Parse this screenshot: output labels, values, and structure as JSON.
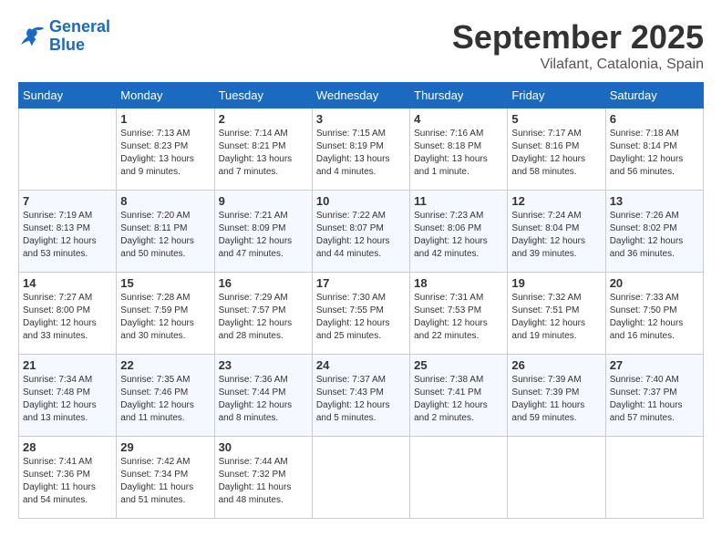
{
  "header": {
    "logo_line1": "General",
    "logo_line2": "Blue",
    "month": "September 2025",
    "location": "Vilafant, Catalonia, Spain"
  },
  "weekdays": [
    "Sunday",
    "Monday",
    "Tuesday",
    "Wednesday",
    "Thursday",
    "Friday",
    "Saturday"
  ],
  "weeks": [
    [
      {
        "day": "",
        "info": ""
      },
      {
        "day": "1",
        "info": "Sunrise: 7:13 AM\nSunset: 8:23 PM\nDaylight: 13 hours\nand 9 minutes."
      },
      {
        "day": "2",
        "info": "Sunrise: 7:14 AM\nSunset: 8:21 PM\nDaylight: 13 hours\nand 7 minutes."
      },
      {
        "day": "3",
        "info": "Sunrise: 7:15 AM\nSunset: 8:19 PM\nDaylight: 13 hours\nand 4 minutes."
      },
      {
        "day": "4",
        "info": "Sunrise: 7:16 AM\nSunset: 8:18 PM\nDaylight: 13 hours\nand 1 minute."
      },
      {
        "day": "5",
        "info": "Sunrise: 7:17 AM\nSunset: 8:16 PM\nDaylight: 12 hours\nand 58 minutes."
      },
      {
        "day": "6",
        "info": "Sunrise: 7:18 AM\nSunset: 8:14 PM\nDaylight: 12 hours\nand 56 minutes."
      }
    ],
    [
      {
        "day": "7",
        "info": "Sunrise: 7:19 AM\nSunset: 8:13 PM\nDaylight: 12 hours\nand 53 minutes."
      },
      {
        "day": "8",
        "info": "Sunrise: 7:20 AM\nSunset: 8:11 PM\nDaylight: 12 hours\nand 50 minutes."
      },
      {
        "day": "9",
        "info": "Sunrise: 7:21 AM\nSunset: 8:09 PM\nDaylight: 12 hours\nand 47 minutes."
      },
      {
        "day": "10",
        "info": "Sunrise: 7:22 AM\nSunset: 8:07 PM\nDaylight: 12 hours\nand 44 minutes."
      },
      {
        "day": "11",
        "info": "Sunrise: 7:23 AM\nSunset: 8:06 PM\nDaylight: 12 hours\nand 42 minutes."
      },
      {
        "day": "12",
        "info": "Sunrise: 7:24 AM\nSunset: 8:04 PM\nDaylight: 12 hours\nand 39 minutes."
      },
      {
        "day": "13",
        "info": "Sunrise: 7:26 AM\nSunset: 8:02 PM\nDaylight: 12 hours\nand 36 minutes."
      }
    ],
    [
      {
        "day": "14",
        "info": "Sunrise: 7:27 AM\nSunset: 8:00 PM\nDaylight: 12 hours\nand 33 minutes."
      },
      {
        "day": "15",
        "info": "Sunrise: 7:28 AM\nSunset: 7:59 PM\nDaylight: 12 hours\nand 30 minutes."
      },
      {
        "day": "16",
        "info": "Sunrise: 7:29 AM\nSunset: 7:57 PM\nDaylight: 12 hours\nand 28 minutes."
      },
      {
        "day": "17",
        "info": "Sunrise: 7:30 AM\nSunset: 7:55 PM\nDaylight: 12 hours\nand 25 minutes."
      },
      {
        "day": "18",
        "info": "Sunrise: 7:31 AM\nSunset: 7:53 PM\nDaylight: 12 hours\nand 22 minutes."
      },
      {
        "day": "19",
        "info": "Sunrise: 7:32 AM\nSunset: 7:51 PM\nDaylight: 12 hours\nand 19 minutes."
      },
      {
        "day": "20",
        "info": "Sunrise: 7:33 AM\nSunset: 7:50 PM\nDaylight: 12 hours\nand 16 minutes."
      }
    ],
    [
      {
        "day": "21",
        "info": "Sunrise: 7:34 AM\nSunset: 7:48 PM\nDaylight: 12 hours\nand 13 minutes."
      },
      {
        "day": "22",
        "info": "Sunrise: 7:35 AM\nSunset: 7:46 PM\nDaylight: 12 hours\nand 11 minutes."
      },
      {
        "day": "23",
        "info": "Sunrise: 7:36 AM\nSunset: 7:44 PM\nDaylight: 12 hours\nand 8 minutes."
      },
      {
        "day": "24",
        "info": "Sunrise: 7:37 AM\nSunset: 7:43 PM\nDaylight: 12 hours\nand 5 minutes."
      },
      {
        "day": "25",
        "info": "Sunrise: 7:38 AM\nSunset: 7:41 PM\nDaylight: 12 hours\nand 2 minutes."
      },
      {
        "day": "26",
        "info": "Sunrise: 7:39 AM\nSunset: 7:39 PM\nDaylight: 11 hours\nand 59 minutes."
      },
      {
        "day": "27",
        "info": "Sunrise: 7:40 AM\nSunset: 7:37 PM\nDaylight: 11 hours\nand 57 minutes."
      }
    ],
    [
      {
        "day": "28",
        "info": "Sunrise: 7:41 AM\nSunset: 7:36 PM\nDaylight: 11 hours\nand 54 minutes."
      },
      {
        "day": "29",
        "info": "Sunrise: 7:42 AM\nSunset: 7:34 PM\nDaylight: 11 hours\nand 51 minutes."
      },
      {
        "day": "30",
        "info": "Sunrise: 7:44 AM\nSunset: 7:32 PM\nDaylight: 11 hours\nand 48 minutes."
      },
      {
        "day": "",
        "info": ""
      },
      {
        "day": "",
        "info": ""
      },
      {
        "day": "",
        "info": ""
      },
      {
        "day": "",
        "info": ""
      }
    ]
  ]
}
